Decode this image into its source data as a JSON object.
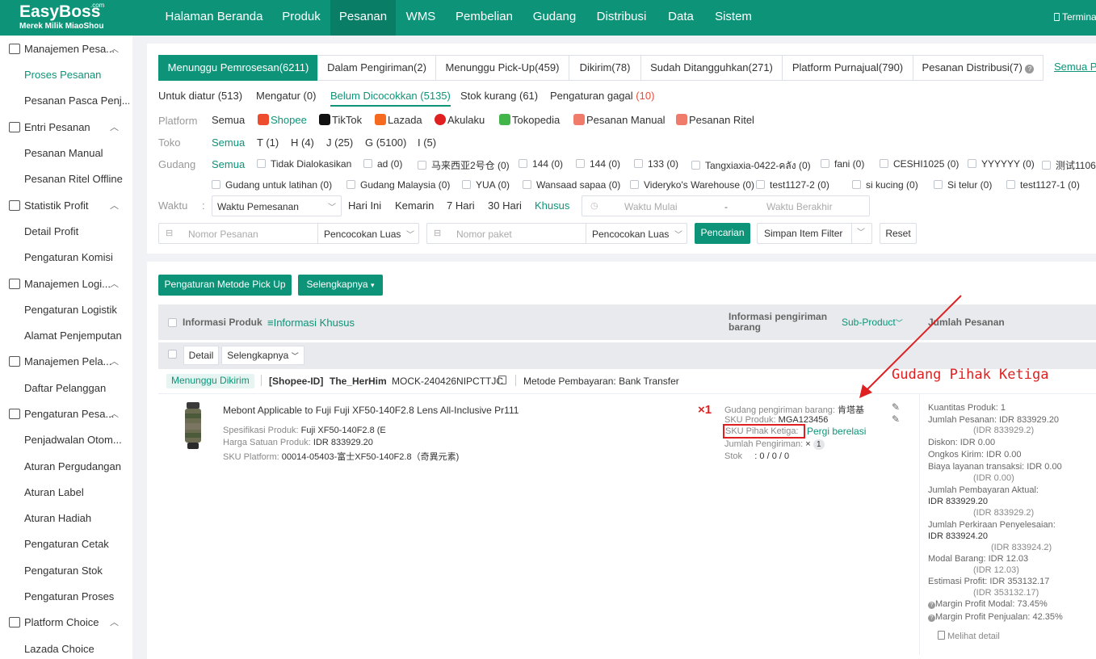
{
  "topbar": {
    "logo": "EasyBoss",
    "logo_com": ".com",
    "logo_sub": "Merek Milik MiaoShou",
    "nav": [
      "Halaman Beranda",
      "Produk",
      "Pesanan",
      "WMS",
      "Pembelian",
      "Gudang",
      "Distribusi",
      "Data",
      "Sistem"
    ],
    "terminal": "Terminal"
  },
  "sidebar": {
    "groups": [
      {
        "label": "Manajemen Pesa...",
        "items": [
          "Proses Pesanan",
          "Pesanan Pasca Penj..."
        ]
      },
      {
        "label": "Entri Pesanan",
        "items": [
          "Pesanan Manual",
          "Pesanan Ritel Offline"
        ]
      },
      {
        "label": "Statistik Profit",
        "items": [
          "Detail Profit",
          "Pengaturan Komisi"
        ]
      },
      {
        "label": "Manajemen Logi...",
        "items": [
          "Pengaturan Logistik",
          "Alamat Penjemputan"
        ]
      },
      {
        "label": "Manajemen Pela...",
        "items": [
          "Daftar Pelanggan"
        ]
      },
      {
        "label": "Pengaturan Pesa...",
        "items": [
          "Penjadwalan Otom...",
          "Aturan Pergudangan",
          "Aturan Label",
          "Aturan Hadiah",
          "Pengaturan Cetak",
          "Pengaturan Stok",
          "Pengaturan Proses"
        ]
      },
      {
        "label": "Platform Choice",
        "items": [
          "Lazada Choice"
        ]
      }
    ]
  },
  "tabs": [
    "Menunggu Pemrosesan(6211)",
    "Dalam Pengiriman(2)",
    "Menunggu Pick-Up(459)",
    "Dikirim(78)",
    "Sudah Ditangguhkan(271)",
    "Platform Purnajual(790)",
    "Pesanan Distribusi(7)"
  ],
  "tabs_more": "Semua Pe",
  "subtabs": [
    {
      "label": "Untuk diatur",
      "count": "(513)"
    },
    {
      "label": "Mengatur",
      "count": "(0)"
    },
    {
      "label": "Belum Dicocokkan",
      "count": "(5135)"
    },
    {
      "label": "Stok kurang",
      "count": "(61)"
    },
    {
      "label": "Pengaturan gagal",
      "count": "(10)"
    }
  ],
  "filters": {
    "platform_label": "Platform",
    "platforms": [
      "Semua",
      "Shopee",
      "TikTok",
      "Lazada",
      "Akulaku",
      "Tokopedia",
      "Pesanan Manual",
      "Pesanan Ritel"
    ],
    "toko_label": "Toko",
    "toko": [
      "Semua",
      "T (1)",
      "H (4)",
      "J (25)",
      "G (5100)",
      "I (5)"
    ],
    "gudang_label": "Gudang",
    "gudang_row1": [
      "Semua",
      "Tidak Dialokasikan",
      "ad (0)",
      "马来西亚2号仓 (0)",
      "144 (0)",
      "144 (0)",
      "133 (0)",
      "Tangxiaxia-0422-คลัง (0)",
      "fani (0)",
      "CESHI1025 (0)",
      "YYYYYY (0)",
      "测试1106"
    ],
    "gudang_row2": [
      "Gudang untuk latihan (0)",
      "Gudang Malaysia (0)",
      "YUA (0)",
      "Wansaad sapaa (0)",
      "Videryko's Warehouse (0)",
      "test1127-2 (0)",
      "si kucing (0)",
      "Si telur (0)",
      "test1127-1 (0)"
    ],
    "waktu_label": "Waktu",
    "waktu_select": "Waktu Pemesanan",
    "waktu_quick": [
      "Hari Ini",
      "Kemarin",
      "7 Hari",
      "30 Hari",
      "Khusus"
    ],
    "waktu_start": "Waktu Mulai",
    "waktu_sep": "-",
    "waktu_end": "Waktu Berakhir",
    "search1_placeholder": "Nomor Pesanan",
    "search1_mode": "Pencocokan Luas",
    "search2_placeholder": "Nomor paket",
    "search2_mode": "Pencocokan Luas",
    "search_button": "Pencarian",
    "save_filter": "Simpan Item Filter",
    "reset": "Reset"
  },
  "actions": {
    "pickup_button": "Pengaturan Metode Pick Up",
    "more_button": "Selengkapnya"
  },
  "table": {
    "col_product": "Informasi Produk",
    "col_special": "Informasi Khusus",
    "col_shipping": "Informasi pengiriman barang",
    "col_subproduct": "Sub-Product",
    "col_amount": "Jumlah Pesanan",
    "detail_button": "Detail",
    "more_button": "Selengkapnya"
  },
  "order": {
    "status": "Menunggu Dikirim",
    "platform_id": "[Shopee-ID]",
    "shop": "The_HerHim",
    "order_no": "MOCK-240426NIPCTTJC",
    "payment": "Metode Pembayaran: Bank Transfer",
    "product_title": "Mebont Applicable to Fuji Fuji XF50-140F2.8 Lens All-Inclusive Pr111",
    "spec_label": "Spesifikasi Produk:",
    "spec_value": "Fuji XF50-140F2.8 (E",
    "price_label": "Harga Satuan Produk:",
    "price_value": "IDR 833929.20",
    "sku_platform_label": "SKU Platform:",
    "sku_platform_value": "00014-05403-富士XF50-140F2.8（奇異元素)",
    "qty_mark": "×1",
    "warehouse_label": "Gudang pengiriman barang:",
    "warehouse_value": "肯塔基",
    "sku_product_label": "SKU Produk:",
    "sku_product_value": "MGA123456",
    "sku_third_label": "SKU Pihak Ketiga:",
    "sku_third_link": "Pergi berelasi",
    "ship_qty_label": "Jumlah Pengiriman:",
    "ship_qty_x": "×",
    "ship_qty_value": "1",
    "stock_label": "Stok",
    "stock_value": ": 0 / 0 / 0",
    "annotation": "Gudang Pihak Ketiga",
    "amount_lines": [
      "Kuantitas Produk: 1",
      "Jumlah Pesanan: IDR 833929.20",
      "(IDR 833929.2)",
      "Diskon: IDR 0.00",
      "Ongkos Kirim: IDR 0.00",
      "Biaya layanan transaksi: IDR 0.00",
      "(IDR 0.00)",
      "Jumlah Pembayaran Aktual:",
      "IDR 833929.20",
      "(IDR 833929.2)",
      "Jumlah Perkiraan Penyelesaian:",
      "IDR 833924.20",
      "(IDR 833924.2)",
      "Modal Barang: IDR 12.03",
      "(IDR 12.03)",
      "Estimasi Profit: IDR 353132.17",
      "(IDR 353132.17)",
      "Margin Profit Modal: 73.45%",
      "Margin Profit Penjualan: 42.35%"
    ],
    "detail_link": "Melihat detail"
  },
  "colors": {
    "brand": "#0d9478",
    "brand_dark": "#0a7d66",
    "annotation": "#e02020",
    "danger": "#e74c3c"
  }
}
